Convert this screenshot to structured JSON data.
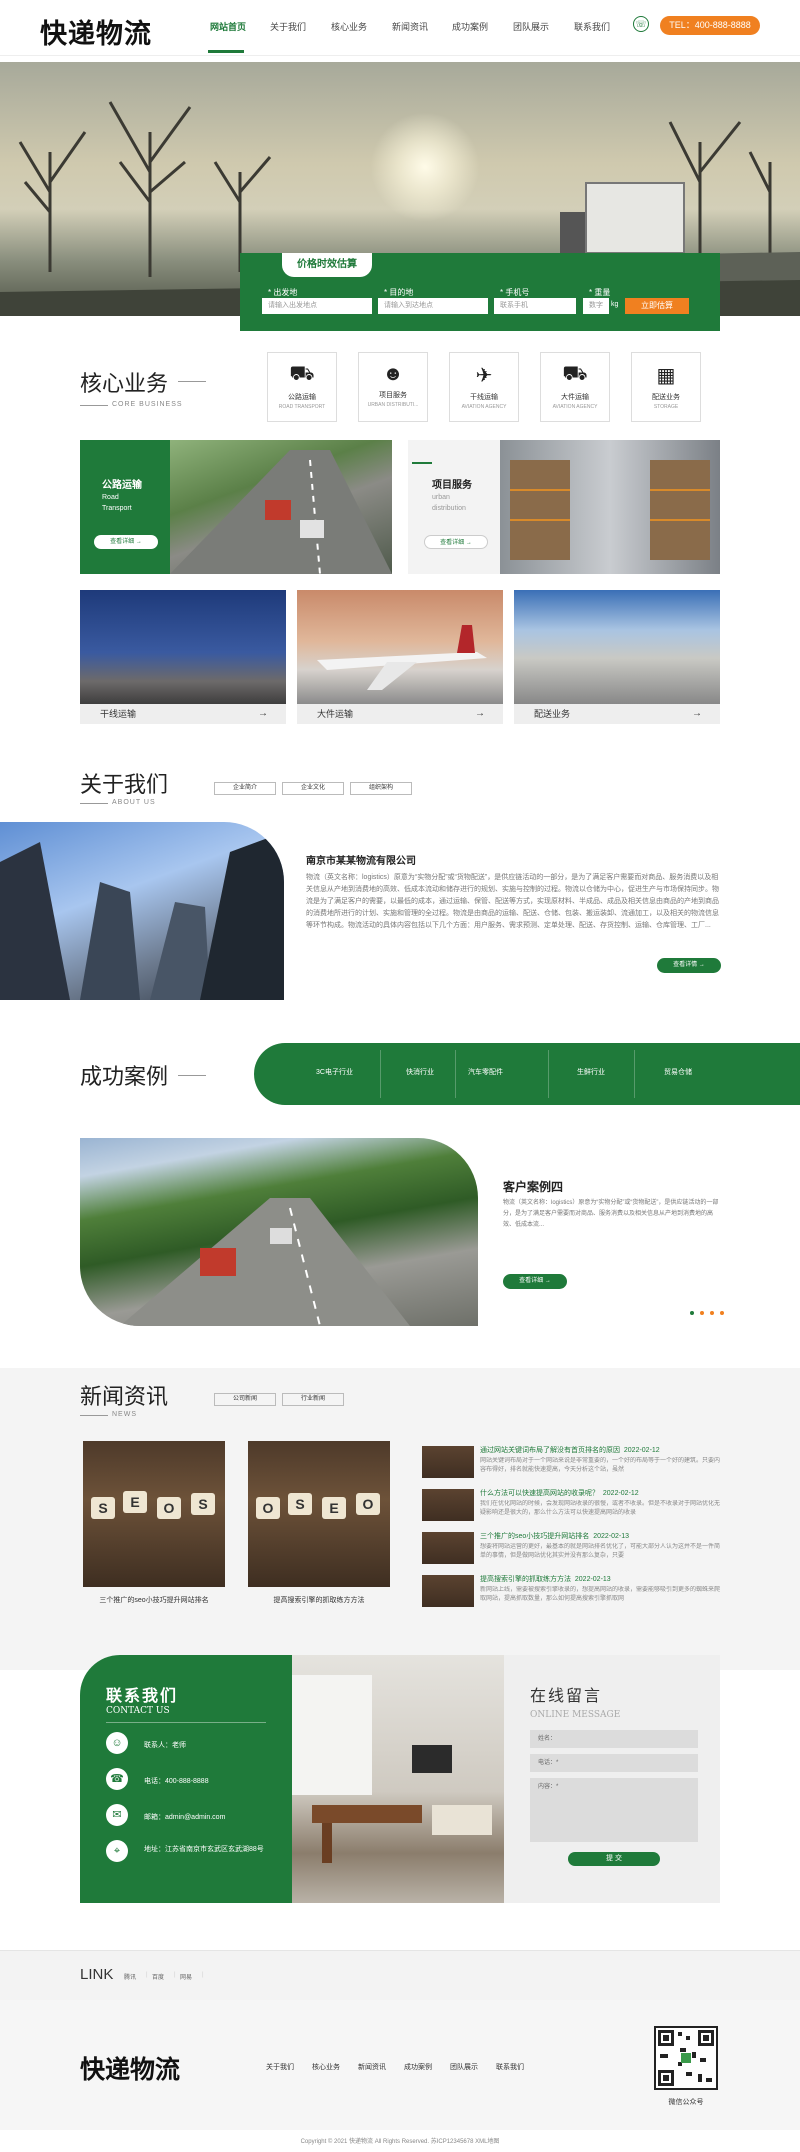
{
  "header": {
    "logo": "快递物流",
    "nav": [
      "网站首页",
      "关于我们",
      "核心业务",
      "新闻资讯",
      "成功案例",
      "团队展示",
      "联系我们"
    ],
    "tel": "TEL：400-888-8888"
  },
  "calc": {
    "title": "价格时效估算",
    "from_label": "* 出发地",
    "from_placeholder": "请输入出发地点",
    "to_label": "* 目的地",
    "to_placeholder": "请输入到达地点",
    "phone_label": "* 手机号",
    "phone_placeholder": "联系手机",
    "weight_label": "* 重量",
    "weight_placeholder": "数字",
    "weight_unit": "kg",
    "submit": "立即估算"
  },
  "core": {
    "title": "核心业务",
    "subtitle": "CORE BUSINESS",
    "icons": [
      {
        "icon": "truck-icon",
        "label": "公路运输",
        "en": "ROAD TRANSPORT"
      },
      {
        "icon": "worker-icon",
        "label": "项目服务",
        "en": "URBAN DISTRIBUTI..."
      },
      {
        "icon": "plane-icon",
        "label": "干线运输",
        "en": "AVIATION AGENCY"
      },
      {
        "icon": "lorry-icon",
        "label": "大件运输",
        "en": "AVIATION AGENCY"
      },
      {
        "icon": "boxes-icon",
        "label": "配送业务",
        "en": "STORAGE"
      }
    ],
    "card1": {
      "title": "公路运输",
      "sub1": "Road",
      "sub2": "Transport",
      "btn": "查看详细 →"
    },
    "card2": {
      "title": "项目服务",
      "sub1": "urban",
      "sub2": "distribution",
      "btn": "查看详细 →"
    },
    "tiles": [
      {
        "label": "干线运输",
        "arrow": "→"
      },
      {
        "label": "大件运输",
        "arrow": "→"
      },
      {
        "label": "配送业务",
        "arrow": "→"
      }
    ]
  },
  "about": {
    "title": "关于我们",
    "subtitle": "ABOUT US",
    "tabs": [
      "企业简介",
      "企业文化",
      "组织架构"
    ],
    "company": "南京市某某物流有限公司",
    "text": "物流（英文名称：logistics）原意为“实物分配”或“货物配送”，是供应链活动的一部分，是为了满足客户需要而对商品、服务消费以及相关信息从产地到消费地的高效、低成本流动和储存进行的规划、实施与控制的过程。物流以仓储为中心，促进生产与市场保持同步。物流是为了满足客户的需要，以最低的成本，通过运输、保管、配送等方式，实现原材料、半成品、成品及相关信息由商品的产地到商品的消费地所进行的计划、实施和管理的全过程。物流是由商品的运输、配送、仓储、包装、搬运装卸、流通加工，以及相关的物流信息等环节构成。物流活动的具体内容包括以下几个方面：用户服务、需求预测、定单处理、配送、存货控制、运输、仓库管理、工厂...",
    "more": "查看详情 →"
  },
  "cases": {
    "title": "成功案例",
    "tabs": [
      "3C电子行业",
      "快消行业",
      "汽车零配件",
      "生鲜行业",
      "贸易仓储"
    ],
    "item_title": "客户案例四",
    "item_text": "物流（英文名称：logistics）原意为“实物分配”或“货物配送”，是供应链活动的一部分，是为了满足客户需要而对商品、服务消费以及相关信息从产地到消费地的高效、低成本流...",
    "btn": "查看详细 →"
  },
  "news": {
    "title": "新闻资讯",
    "subtitle": "NEWS",
    "tabs": [
      "公司新闻",
      "行业新闻"
    ],
    "featured": [
      {
        "caption": "三个推广的seo小技巧提升网站排名"
      },
      {
        "caption": "提高搜索引擎的抓取练方方法"
      }
    ],
    "list": [
      {
        "title": "通过网站关键词布局了解没有首页排名的原因",
        "date": "2022-02-12",
        "desc": "网站关键词布局对于一个网站来说是非常重要的，一个好的布局等于一个好的建筑。只要内容布得好，排名就能快速提高，今天分析这个站，虽然"
      },
      {
        "title": "什么方法可以快速提高网站的收录呢？",
        "date": "2022-02-12",
        "desc": "我们在优化网站的时候，会发现网站收录的很慢，或者不收录。但是不收录对于网站优化无疑影响还是很大的，那么什么方法可以快速提高网站的收录"
      },
      {
        "title": "三个推广的seo小技巧提升网站排名",
        "date": "2022-02-13",
        "desc": "想要将网站运营的更好，最基本的就是网站排名优化了，可能大部分人认为这并不是一件简单的事情，但是做网站优化其实并没有那么复杂，只要"
      },
      {
        "title": "提高搜索引擎的抓取练方方法",
        "date": "2022-02-13",
        "desc": "新网站上线，需要被搜索引擎收录的，想提高网站的收录，需要能够吸引到更多的蜘蛛来爬取网站，提高抓取数量，那么如何提高搜索引擎抓取网"
      }
    ]
  },
  "contact": {
    "title": "联系我们",
    "subtitle": "CONTACT US",
    "items": [
      {
        "icon": "user-icon",
        "text": "联系人：老师"
      },
      {
        "icon": "phone-icon",
        "text": "电话：400-888-8888"
      },
      {
        "icon": "mail-icon",
        "text": "邮箱：admin@admin.com"
      },
      {
        "icon": "location-icon",
        "text": "地址：江苏省南京市玄武区玄武湖88号"
      }
    ],
    "form_title": "在线留言",
    "form_subtitle": "ONLINE MESSAGE",
    "name_ph": "姓名：",
    "phone_ph": "电话：*",
    "content_ph": "内容：*",
    "submit": "提 交"
  },
  "links": {
    "title": "LINK",
    "items": [
      "腾讯",
      "百度",
      "网易"
    ]
  },
  "footer": {
    "logo": "快递物流",
    "nav": [
      "关于我们",
      "核心业务",
      "新闻资讯",
      "成功案例",
      "团队展示",
      "联系我们"
    ],
    "qr_caption": "微信公众号",
    "copyright": "Copyright © 2021 快递物流 All Rights Reserved. 苏ICP12345678 XML地图"
  },
  "colors": {
    "primary": "#1f7a3a",
    "accent": "#f08020"
  }
}
